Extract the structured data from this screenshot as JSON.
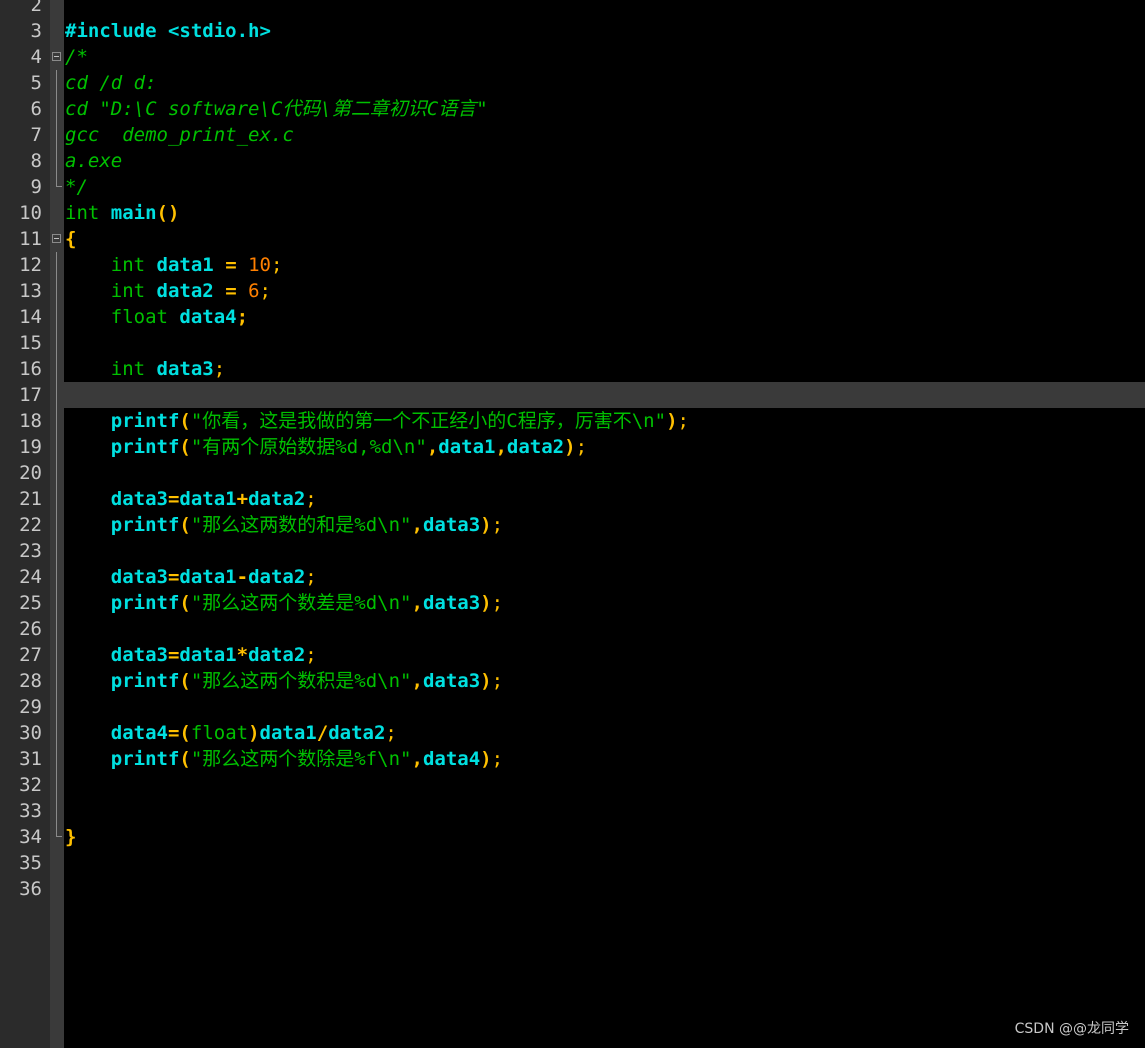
{
  "editor": {
    "line_numbers": [
      "2",
      "3",
      "4",
      "5",
      "6",
      "7",
      "8",
      "9",
      "10",
      "11",
      "12",
      "13",
      "14",
      "15",
      "16",
      "17",
      "18",
      "19",
      "20",
      "21",
      "22",
      "23",
      "24",
      "25",
      "26",
      "27",
      "28",
      "29",
      "30",
      "31",
      "32",
      "33",
      "34",
      "35",
      "36"
    ],
    "current_line": "17",
    "code": {
      "l3": {
        "a": "#include <stdio.h>"
      },
      "l4": {
        "a": "/*"
      },
      "l5": {
        "a": "cd /d d:"
      },
      "l6": {
        "a": "cd \"D:\\C software\\C代码\\第二章初识C语言\""
      },
      "l7": {
        "a": "gcc  demo_print_ex.c"
      },
      "l8": {
        "a": "a.exe"
      },
      "l9": {
        "a": "*/"
      },
      "l10": {
        "type": "int",
        "name": "main",
        "parens": "()"
      },
      "l11": {
        "brace": "{"
      },
      "l12": {
        "indent": "    ",
        "type": "int",
        "name": "data1",
        "eq": " = ",
        "val": "10",
        "semi": ";"
      },
      "l13": {
        "indent": "    ",
        "type": "int",
        "name": "data2",
        "eq": " = ",
        "val": "6",
        "semi": ";"
      },
      "l14": {
        "indent": "    ",
        "type": "float",
        "name": "data4",
        "semi": ";"
      },
      "l16": {
        "indent": "    ",
        "type": "int",
        "name": "data3",
        "semi": ";"
      },
      "l18": {
        "indent": "    ",
        "fn": "printf",
        "open": "(",
        "str": "\"你看，这是我做的第一个不正经小的C程序，厉害不\\n\"",
        "close": ")",
        "semi": ";"
      },
      "l19": {
        "indent": "    ",
        "fn": "printf",
        "open": "(",
        "str": "\"有两个原始数据%d,%d\\n\"",
        "c1": ",",
        "a1": "data1",
        "c2": ",",
        "a2": "data2",
        "close": ")",
        "semi": ";"
      },
      "l21": {
        "indent": "    ",
        "lhs": "data3",
        "eq": "=",
        "x": "data1",
        "op": "+",
        "y": "data2",
        "semi": ";"
      },
      "l22": {
        "indent": "    ",
        "fn": "printf",
        "open": "(",
        "str": "\"那么这两数的和是%d\\n\"",
        "c1": ",",
        "a1": "data3",
        "close": ")",
        "semi": ";"
      },
      "l24": {
        "indent": "    ",
        "lhs": "data3",
        "eq": "=",
        "x": "data1",
        "op": "-",
        "y": "data2",
        "semi": ";"
      },
      "l25": {
        "indent": "    ",
        "fn": "printf",
        "open": "(",
        "str": "\"那么这两个数差是%d\\n\"",
        "c1": ",",
        "a1": "data3",
        "close": ")",
        "semi": ";"
      },
      "l27": {
        "indent": "    ",
        "lhs": "data3",
        "eq": "=",
        "x": "data1",
        "op": "*",
        "y": "data2",
        "semi": ";"
      },
      "l28": {
        "indent": "    ",
        "fn": "printf",
        "open": "(",
        "str": "\"那么这两个数积是%d\\n\"",
        "c1": ",",
        "a1": "data3",
        "close": ")",
        "semi": ";"
      },
      "l30": {
        "indent": "    ",
        "lhs": "data4",
        "eq": "=",
        "open": "(",
        "cast": "float",
        "close1": ")",
        "x": "data1",
        "op": "/",
        "y": "data2",
        "semi": ";"
      },
      "l31": {
        "indent": "    ",
        "fn": "printf",
        "open": "(",
        "str": "\"那么这两个数除是%f\\n\"",
        "c1": ",",
        "a1": "data4",
        "close": ")",
        "semi": ";"
      },
      "l34": {
        "brace": "}"
      }
    }
  },
  "watermark": "CSDN @@龙同学",
  "colors": {
    "background": "#000000",
    "gutter": "#2b2b2b",
    "line_number": "#c8c8c8",
    "identifier": "#00e0e0",
    "comment": "#00c000",
    "number": "#ff8000",
    "operator": "#ffc000",
    "current_line": "#3a3a3a"
  }
}
